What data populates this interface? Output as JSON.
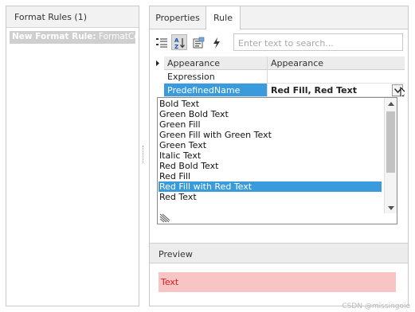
{
  "left_panel": {
    "header": "Format Rules (1)",
    "item_bold": "New Format Rule:",
    "item_rest": " FormatCor"
  },
  "tabs": [
    {
      "label": "Properties"
    },
    {
      "label": "Rule"
    }
  ],
  "toolbar": {
    "search_placeholder": "Enter text to search..."
  },
  "grid": {
    "header": {
      "name": "Appearance",
      "value": "Appearance"
    },
    "rows": [
      {
        "name": "Expression",
        "value": ""
      },
      {
        "name": "PredefinedName",
        "value": "Red Fill, Red Text"
      }
    ]
  },
  "dropdown": {
    "items": [
      "Bold Text",
      "Green Bold Text",
      "Green Fill",
      "Green Fill with Green Text",
      "Green Text",
      "Italic Text",
      "Red Bold Text",
      "Red Fill",
      "Red Fill with Red Text",
      "Red Text"
    ],
    "selected": "Red Fill with Red Text"
  },
  "preview": {
    "header": "Preview",
    "sample_text": "Text"
  },
  "colors": {
    "accent": "#3a9bdc",
    "preview_fill": "#f9c4c4",
    "preview_text": "#d62020"
  },
  "watermark": "CSDN @missingoio"
}
